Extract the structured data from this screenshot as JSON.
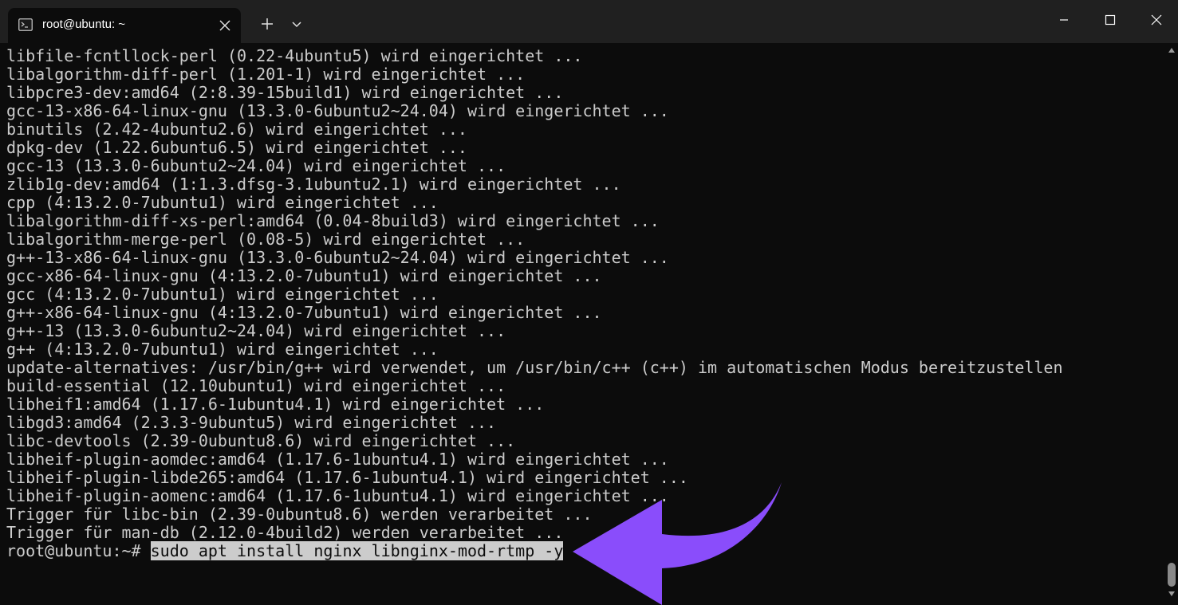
{
  "tab": {
    "title": "root@ubuntu: ~"
  },
  "terminal": {
    "lines": [
      "libfile-fcntllock-perl (0.22-4ubuntu5) wird eingerichtet ...",
      "libalgorithm-diff-perl (1.201-1) wird eingerichtet ...",
      "libpcre3-dev:amd64 (2:8.39-15build1) wird eingerichtet ...",
      "gcc-13-x86-64-linux-gnu (13.3.0-6ubuntu2~24.04) wird eingerichtet ...",
      "binutils (2.42-4ubuntu2.6) wird eingerichtet ...",
      "dpkg-dev (1.22.6ubuntu6.5) wird eingerichtet ...",
      "gcc-13 (13.3.0-6ubuntu2~24.04) wird eingerichtet ...",
      "zlib1g-dev:amd64 (1:1.3.dfsg-3.1ubuntu2.1) wird eingerichtet ...",
      "cpp (4:13.2.0-7ubuntu1) wird eingerichtet ...",
      "libalgorithm-diff-xs-perl:amd64 (0.04-8build3) wird eingerichtet ...",
      "libalgorithm-merge-perl (0.08-5) wird eingerichtet ...",
      "g++-13-x86-64-linux-gnu (13.3.0-6ubuntu2~24.04) wird eingerichtet ...",
      "gcc-x86-64-linux-gnu (4:13.2.0-7ubuntu1) wird eingerichtet ...",
      "gcc (4:13.2.0-7ubuntu1) wird eingerichtet ...",
      "g++-x86-64-linux-gnu (4:13.2.0-7ubuntu1) wird eingerichtet ...",
      "g++-13 (13.3.0-6ubuntu2~24.04) wird eingerichtet ...",
      "g++ (4:13.2.0-7ubuntu1) wird eingerichtet ...",
      "update-alternatives: /usr/bin/g++ wird verwendet, um /usr/bin/c++ (c++) im automatischen Modus bereitzustellen",
      "build-essential (12.10ubuntu1) wird eingerichtet ...",
      "libheif1:amd64 (1.17.6-1ubuntu4.1) wird eingerichtet ...",
      "libgd3:amd64 (2.3.3-9ubuntu5) wird eingerichtet ...",
      "libc-devtools (2.39-0ubuntu8.6) wird eingerichtet ...",
      "libheif-plugin-aomdec:amd64 (1.17.6-1ubuntu4.1) wird eingerichtet ...",
      "libheif-plugin-libde265:amd64 (1.17.6-1ubuntu4.1) wird eingerichtet ...",
      "libheif-plugin-aomenc:amd64 (1.17.6-1ubuntu4.1) wird eingerichtet ...",
      "Trigger für libc-bin (2.39-0ubuntu8.6) werden verarbeitet ...",
      "Trigger für man-db (2.12.0-4build2) werden verarbeitet ..."
    ],
    "prompt": "root@ubuntu:~# ",
    "command": "sudo apt install nginx libnginx-mod-rtmp -y"
  },
  "icons": {
    "tab_icon": "terminal-icon",
    "tab_close": "close-icon",
    "new_tab": "plus-icon",
    "dropdown": "chevron-down-icon",
    "minimize": "minimize-icon",
    "maximize": "maximize-icon",
    "close": "close-icon"
  },
  "colors": {
    "background": "#0c0c0c",
    "titlebar": "#202020",
    "text": "#cccccc",
    "arrow": "#8a4dfb"
  }
}
